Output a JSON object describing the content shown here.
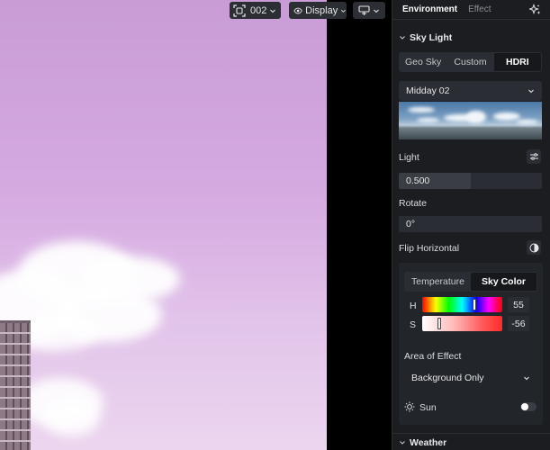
{
  "toolbar": {
    "camera_label": "002",
    "display_label": "Display"
  },
  "panel": {
    "tabs": [
      {
        "label": "Environment",
        "active": true
      },
      {
        "label": "Effect",
        "active": false
      }
    ],
    "sky_light": {
      "title": "Sky Light",
      "modes": [
        {
          "label": "Geo Sky",
          "active": false
        },
        {
          "label": "Custom",
          "active": false
        },
        {
          "label": "HDRI",
          "active": true
        }
      ],
      "hdri_preset": "Midday 02",
      "light_label": "Light",
      "light_value": "0.500",
      "light_fraction": 0.5,
      "rotate_label": "Rotate",
      "rotate_value": "0°",
      "flip_label": "Flip Horizontal",
      "color_modes": [
        {
          "label": "Temperature",
          "active": false
        },
        {
          "label": "Sky Color",
          "active": true
        }
      ],
      "h_label": "H",
      "h_value": "55",
      "s_label": "S",
      "s_value": "-56",
      "area_label": "Area of Effect",
      "area_value": "Background Only",
      "sun_label": "Sun",
      "sun_enabled": false
    },
    "weather": {
      "title": "Weather"
    }
  },
  "colors": {
    "panel_bg": "#1b1d21",
    "field_bg": "#2a2d33",
    "sky_tint": "#d4a8e0"
  }
}
